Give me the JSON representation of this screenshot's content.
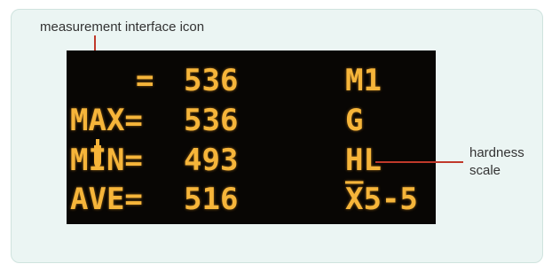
{
  "annotations": {
    "icon_label": "measurement interface icon",
    "scale_label_line1": "hardness",
    "scale_label_line2": "scale"
  },
  "display": {
    "rows": [
      {
        "label": "",
        "equals": "=",
        "value": "536",
        "right": "M1"
      },
      {
        "label": "MAX=",
        "value": "536",
        "right": "G"
      },
      {
        "label": "MIN=",
        "value": "493",
        "right": "HL"
      },
      {
        "label": "AVE=",
        "value": "516",
        "right": "X̅5-5"
      }
    ],
    "icon": "probe-icon",
    "text_color": "#f6b53a",
    "background_color": "#080604"
  },
  "colors": {
    "panel_background": "#ebf5f3",
    "leader_line": "#c0392b"
  }
}
